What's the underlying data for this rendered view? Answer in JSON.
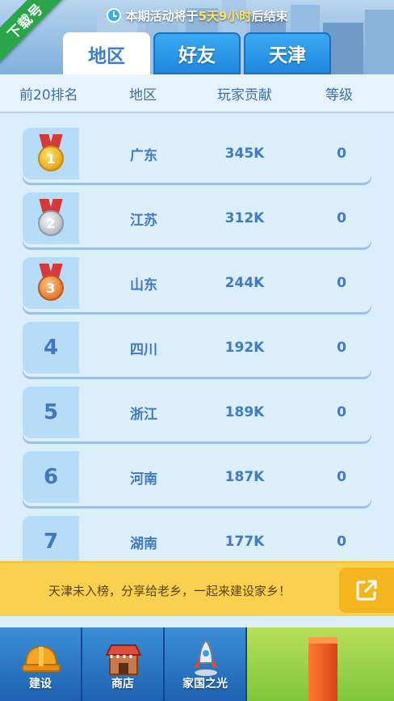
{
  "banner": {
    "notice_prefix": "本期活动将于",
    "notice_highlight": "5天9小时",
    "notice_suffix": "后结束",
    "ribbon": "下载号"
  },
  "tabs": [
    {
      "label": "地区",
      "active": true
    },
    {
      "label": "好友",
      "active": false
    },
    {
      "label": "天津",
      "active": false
    }
  ],
  "headers": {
    "rank": "前20排名",
    "region": "地区",
    "contribution": "玩家贡献",
    "level": "等级"
  },
  "rows": [
    {
      "rank": "1",
      "region": "广东",
      "contribution": "345K",
      "level": "0",
      "medal": "gold"
    },
    {
      "rank": "2",
      "region": "江苏",
      "contribution": "312K",
      "level": "0",
      "medal": "silver"
    },
    {
      "rank": "3",
      "region": "山东",
      "contribution": "244K",
      "level": "0",
      "medal": "bronze"
    },
    {
      "rank": "4",
      "region": "四川",
      "contribution": "192K",
      "level": "0"
    },
    {
      "rank": "5",
      "region": "浙江",
      "contribution": "189K",
      "level": "0"
    },
    {
      "rank": "6",
      "region": "河南",
      "contribution": "187K",
      "level": "0"
    },
    {
      "rank": "7",
      "region": "湖南",
      "contribution": "177K",
      "level": "0"
    }
  ],
  "share": {
    "text": "天津未入榜，分享给老乡，一起来建设家乡！",
    "icon": "share-icon"
  },
  "nav": {
    "build": "建设",
    "shop": "商店",
    "glory": "家国之光"
  },
  "colors": {
    "accent": "#3d7fc8",
    "tab_blue": "#2796e8",
    "share_yellow": "#fad14e",
    "nav_green": "#8fd145"
  }
}
